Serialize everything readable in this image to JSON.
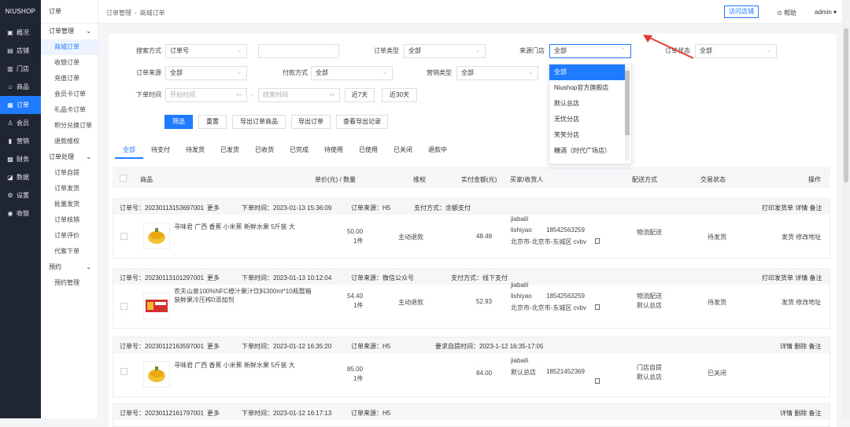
{
  "brand": "NIUSHOP",
  "rail": [
    {
      "icon": "chart-icon",
      "glyph": "▣",
      "label": "概况"
    },
    {
      "icon": "store-icon",
      "glyph": "▤",
      "label": "店铺"
    },
    {
      "icon": "shop-icon",
      "glyph": "▥",
      "label": "门店"
    },
    {
      "icon": "goods-icon",
      "glyph": "⌂",
      "label": "商品"
    },
    {
      "icon": "order-icon",
      "glyph": "▦",
      "label": "订单"
    },
    {
      "icon": "member-icon",
      "glyph": "♙",
      "label": "会员"
    },
    {
      "icon": "marketing-icon",
      "glyph": "▮",
      "label": "营销"
    },
    {
      "icon": "finance-icon",
      "glyph": "▩",
      "label": "财务"
    },
    {
      "icon": "data-icon",
      "glyph": "◪",
      "label": "数据"
    },
    {
      "icon": "settings-icon",
      "glyph": "⚙",
      "label": "设置"
    },
    {
      "icon": "cashier-icon",
      "glyph": "◉",
      "label": "收银"
    }
  ],
  "sub": {
    "title": "订单",
    "g1": "订单管理",
    "g1items": [
      "商城订单",
      "收银订单",
      "充值订单",
      "会员卡订单",
      "礼品卡订单",
      "积分兑换订单",
      "退款维权"
    ],
    "g2": "订单处理",
    "g2items": [
      "订单自提",
      "订单发货",
      "批量发货",
      "订单核销",
      "订单评价",
      "代客下单"
    ],
    "g3": "预约",
    "g3items": [
      "预约管理"
    ]
  },
  "top": {
    "crumb1": "订单管理",
    "sep": "-",
    "crumb2": "商城订单",
    "visit": "访问店铺",
    "help": "帮助",
    "admin": "admin"
  },
  "filters": {
    "search_type_label": "搜索方式",
    "search_type": "订单号",
    "order_type_label": "订单类型",
    "order_type": "全部",
    "store_label": "来源门店",
    "store": "全部",
    "status_label": "订单状态",
    "status": "全部",
    "source_label": "订单来源",
    "source": "全部",
    "pay_label": "付款方式",
    "pay": "全部",
    "mk_label": "营销类型",
    "mk": "全部",
    "time_label": "下单时间",
    "start_ph": "开始时间",
    "dash": "-",
    "end_ph": "结束时间",
    "d7": "近7天",
    "d30": "近30天"
  },
  "actions": {
    "filter": "筛选",
    "reset": "重置",
    "export_goods": "导出订单商品",
    "export_order": "导出订单",
    "export_log": "查看导出记录"
  },
  "tabs": [
    "全部",
    "待支付",
    "待发货",
    "已发货",
    "已收货",
    "已完成",
    "待使用",
    "已使用",
    "已关闭",
    "退款中"
  ],
  "headers": {
    "goods": "商品",
    "price": "单价(元) / 数量",
    "rights": "维权",
    "paid": "实付金额(元)",
    "buyer": "买家/收货人",
    "ship": "配送方式",
    "state": "交易状态",
    "op": "操作"
  },
  "dropdown": [
    "全部",
    "Niushop官方旗舰店",
    "默认总店",
    "无忧分店",
    "笑笑分店",
    "糖酒（时代广场店）"
  ],
  "orders": [
    {
      "no": "订单号：20230113153697001",
      "more": "更多",
      "time": "下单时间：2023-01-13 15:36:09",
      "src": "订单来源：H5",
      "pay": "支付方式：余额支付",
      "ops": "打印发货单 详情 备注",
      "goods": "寻味君 广西 香蕉 小米蕉 新鲜水果 5斤装 大",
      "price": "50.00",
      "qty": "1件",
      "refund": "主动退款",
      "paid": "48.48",
      "buyer": "jiabaili",
      "name": "lishiyao",
      "phone": "18542563259",
      "addr": "北京市-北京市-东城区 cvbv",
      "ship": "物流配送",
      "ship2": "",
      "state": "待发货",
      "bops": "发货 修改地址"
    },
    {
      "no": "订单号：20230113101297001",
      "more": "更多",
      "time": "下单时间：2023-01-13 10:12:04",
      "src": "订单来源：微信公众号",
      "pay": "支付方式：线下支付",
      "ops": "打印发货单 详情 备注",
      "goods": "农夫山泉100%NFC橙汁果汁饮料300ml*10瓶整箱装鲜果冷压榨0添加剂",
      "price": "54.40",
      "qty": "1件",
      "refund": "主动退款",
      "paid": "52.93",
      "buyer": "jiabaili",
      "name": "lishiyao",
      "phone": "18542563259",
      "addr": "北京市-北京市-东城区 cvbv",
      "ship": "物流配送",
      "ship2": "默认总店",
      "state": "待发货",
      "bops": "发货 修改地址"
    },
    {
      "no": "订单号：20230112163597001",
      "more": "更多",
      "time": "下单时间：2023-01-12 16:35:20",
      "src": "订单来源：H5",
      "pay": "要求自提时间：2023-1-12 16:35-17:05",
      "ops": "详情 删除 备注",
      "goods": "寻味君 广西 香蕉 小米蕉 新鲜水果 5斤装 大",
      "price": "85.00",
      "qty": "1件",
      "refund": "",
      "paid": "84.00",
      "buyer": "jiabaili",
      "name": "默认总店",
      "phone": "18521452369",
      "addr": "",
      "ship": "门店自提",
      "ship2": "默认总店",
      "state": "已关闭",
      "bops": ""
    },
    {
      "no": "订单号：20230112161797001",
      "more": "更多",
      "time": "下单时间：2023-01-12 16:17:13",
      "src": "订单来源：H5",
      "ops": "详情 删除 备注"
    }
  ]
}
